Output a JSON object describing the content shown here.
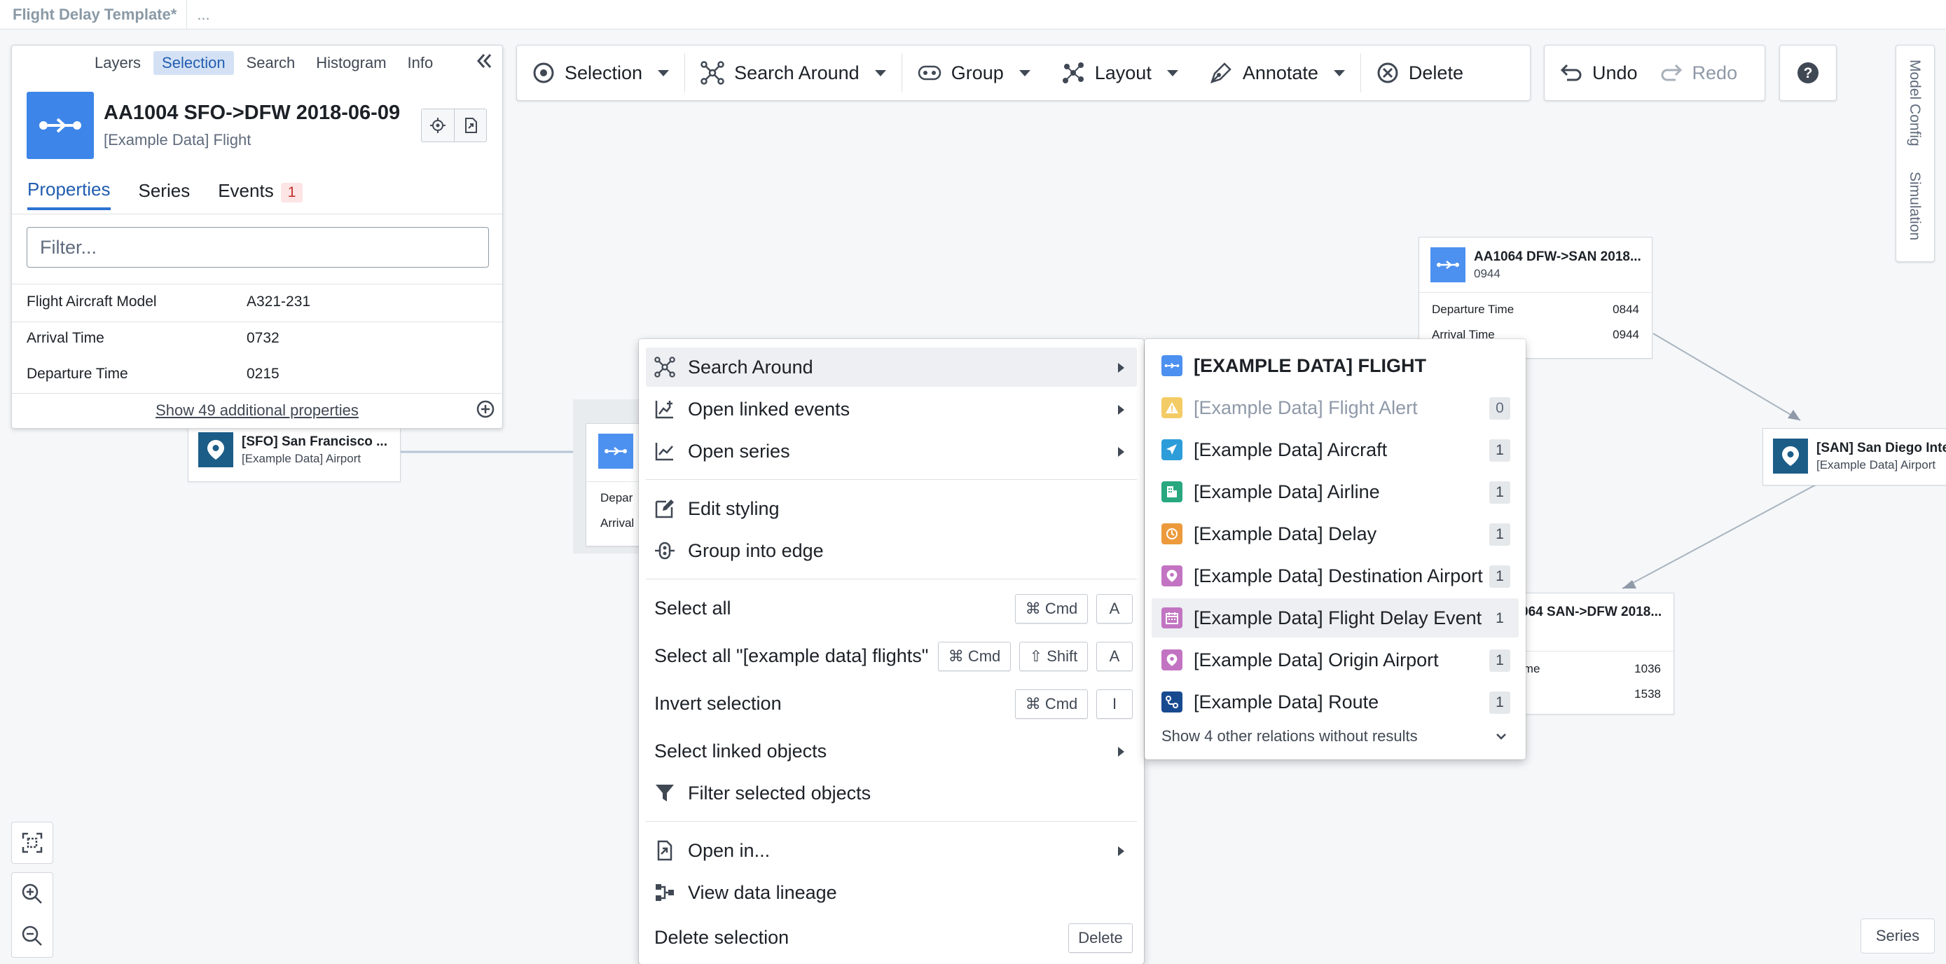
{
  "app": {
    "tab_title": "Flight Delay Template*",
    "more": "..."
  },
  "colors": {
    "accent": "#2d72d2",
    "node_icon": "#4c90f0",
    "airport_icon": "#1c5d88"
  },
  "panel": {
    "tabs": [
      "Layers",
      "Selection",
      "Search",
      "Histogram",
      "Info"
    ],
    "active_tab": "Selection",
    "object_title": "AA1004 SFO->DFW 2018-06-09",
    "object_type": "[Example Data] Flight",
    "subtabs": {
      "properties": "Properties",
      "series": "Series",
      "events": "Events",
      "events_count": "1"
    },
    "filter_placeholder": "Filter...",
    "properties": [
      {
        "key": "Flight Aircraft Model",
        "value": "A321-231"
      },
      {
        "key": "Arrival Time",
        "value": "0732"
      },
      {
        "key": "Departure Time",
        "value": "0215"
      }
    ],
    "show_more": "Show 49 additional properties"
  },
  "toolbar": {
    "selection": "Selection",
    "search_around": "Search Around",
    "group": "Group",
    "layout": "Layout",
    "annotate": "Annotate",
    "delete": "Delete",
    "undo": "Undo",
    "redo": "Redo",
    "help": "?"
  },
  "sidetabs": {
    "model_config": "Model Config",
    "simulation": "Simulation"
  },
  "series_button": "Series",
  "nodes": {
    "sfo": {
      "title": "[SFO] San Francisco ...",
      "subtitle": "[Example Data] Airport"
    },
    "center": {
      "row1": "Depar",
      "row2": "Arrival"
    },
    "aa1064a": {
      "title": "AA1064 DFW->SAN 2018...",
      "subtitle": "0944",
      "row1_key": "Departure Time",
      "row1_val": "0844",
      "row2_key": "Arrival Time",
      "row2_val": "0944"
    },
    "san": {
      "title": "[SAN] San Diego Inte",
      "subtitle": "[Example Data] Airport"
    },
    "aa1064b": {
      "title": "064 SAN->DFW 2018...",
      "row1_key": "ime",
      "row1_val": "1036",
      "row2_val": "1538"
    }
  },
  "context_menu": {
    "items": [
      {
        "label": "Search Around",
        "icon": "search-around-icon",
        "submenu": true
      },
      {
        "label": "Open linked events",
        "icon": "linked-events-icon",
        "submenu": true
      },
      {
        "label": "Open series",
        "icon": "series-icon",
        "submenu": true
      },
      {
        "label": "Edit styling",
        "icon": "edit-icon"
      },
      {
        "label": "Group into edge",
        "icon": "group-edge-icon"
      },
      {
        "label": "Select all"
      },
      {
        "label": "Select all \"[example data] flights\""
      },
      {
        "label": "Invert selection"
      },
      {
        "label": "Select linked objects",
        "submenu": true
      },
      {
        "label": "Filter selected objects",
        "icon": "filter-icon"
      },
      {
        "label": "Open in...",
        "icon": "open-in-icon",
        "submenu": true
      },
      {
        "label": "View data lineage",
        "icon": "lineage-icon"
      },
      {
        "label": "Delete selection"
      }
    ],
    "shortcuts": {
      "cmd": "⌘ Cmd",
      "shift": "⇧ Shift",
      "a": "A",
      "i": "I",
      "delete": "Delete"
    }
  },
  "search_around_menu": {
    "header": "[EXAMPLE DATA] FLIGHT",
    "items": [
      {
        "label": "[Example Data] Flight Alert",
        "count": "0",
        "color": "#f0b726"
      },
      {
        "label": "[Example Data] Aircraft",
        "count": "1",
        "color": "#2d9dd9"
      },
      {
        "label": "[Example Data] Airline",
        "count": "1",
        "color": "#29a77f"
      },
      {
        "label": "[Example Data] Delay",
        "count": "1",
        "color": "#ec9a3c"
      },
      {
        "label": "[Example Data] Destination Airport",
        "count": "1",
        "color": "#c274c2"
      },
      {
        "label": "[Example Data] Flight Delay Event",
        "count": "1",
        "color": "#c274c2"
      },
      {
        "label": "[Example Data] Origin Airport",
        "count": "1",
        "color": "#c274c2"
      },
      {
        "label": "[Example Data] Route",
        "count": "1",
        "color": "#184a90"
      }
    ],
    "footer": "Show 4 other relations without results"
  }
}
